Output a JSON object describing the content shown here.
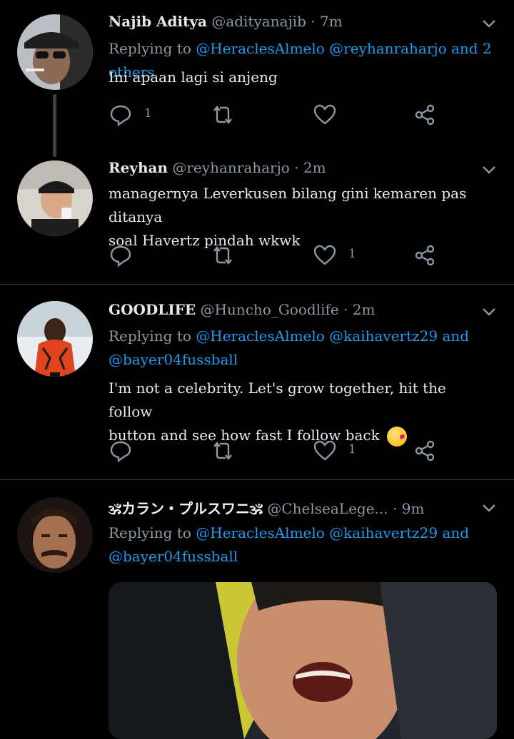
{
  "tweets": [
    {
      "name": "Najib Aditya",
      "handle": "@adityanajib",
      "dot": "·",
      "time": "7m",
      "replying_prefix": "Replying to",
      "replying_mentions": "@HeraclesAlmelo @reyhanraharjo and 2 others",
      "text": "Ini apaan lagi si anjeng",
      "reply_count": "1",
      "retweet_count": "",
      "like_count": ""
    },
    {
      "name": "Reyhan",
      "handle": "@reyhanraharjo",
      "dot": "·",
      "time": "2m",
      "text_line1": "managernya Leverkusen bilang gini kemaren pas ditanya",
      "text_line2": "soal Havertz pindah wkwk",
      "reply_count": "",
      "retweet_count": "",
      "like_count": "1"
    },
    {
      "name": "GOODLIFE",
      "handle": "@Huncho_Goodlife",
      "dot": "·",
      "time": "2m",
      "replying_prefix": "Replying to",
      "replying_mentions_line1": "@HeraclesAlmelo @kaihavertz29 and",
      "replying_mentions_line2": "@bayer04fussball",
      "text_line1": "I'm not a celebrity. Let's grow together, hit the follow",
      "text_line2": "button and see how fast I follow back",
      "reply_count": "",
      "retweet_count": "",
      "like_count": "1"
    },
    {
      "name": "🕉カラン・プルスワニ🕉",
      "handle": "@ChelseaLege...",
      "dot": "·",
      "time": "9m",
      "replying_prefix": "Replying to",
      "replying_mentions_line1": "@HeraclesAlmelo @kaihavertz29 and",
      "replying_mentions_line2": "@bayer04fussball"
    }
  ],
  "icons": {
    "reply": "reply-icon",
    "retweet": "retweet-icon",
    "like": "heart-icon",
    "share": "share-icon",
    "more": "chevron-down-icon"
  },
  "colors": {
    "background": "#000000",
    "mention": "#1d9bf0",
    "muted": "#8b98a5",
    "divider": "#2f3336"
  }
}
